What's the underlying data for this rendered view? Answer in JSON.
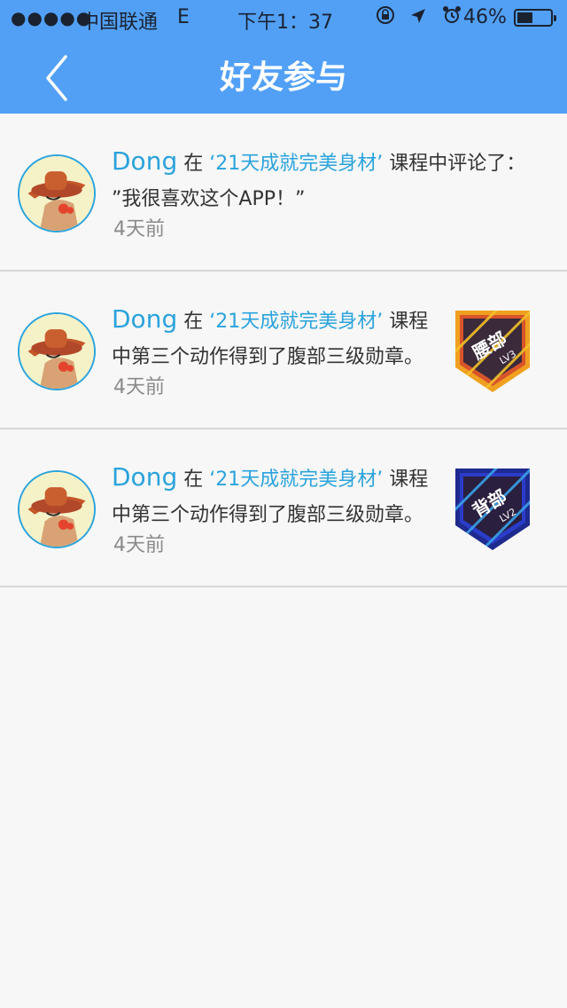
{
  "status_bar": {
    "signal": "●●●●●",
    "carrier": "中国联通",
    "network": "E",
    "time": "下午1：37",
    "icons": [
      "rotation-lock-icon",
      "location-arrow-icon",
      "alarm-icon"
    ],
    "battery_percent_text": "46%",
    "battery_level": 0.46
  },
  "header": {
    "title": "好友参与",
    "back_icon": "chevron-left-icon",
    "background_color": "#52a0f6"
  },
  "feed": [
    {
      "user": "Dong",
      "prefix": " 在 ",
      "course": "‘21天成就完美身材’",
      "suffix": " 课程中评论了：",
      "detail": "”我很喜欢这个APP！”",
      "time": "4天前",
      "badge": null
    },
    {
      "user": "Dong",
      "prefix": " 在 ",
      "course": "‘21天成就完美身材’",
      "suffix": " 课程",
      "detail": "中第三个动作得到了腹部三级勋章。",
      "time": "4天前",
      "badge": {
        "name": "腰部",
        "level": "LV3",
        "color": "#f0a020"
      }
    },
    {
      "user": "Dong",
      "prefix": " 在 ",
      "course": "‘21天成就完美身材’",
      "suffix": " 课程",
      "detail": "中第三个动作得到了腹部三级勋章。",
      "time": "4天前",
      "badge": {
        "name": "背部",
        "level": "LV2",
        "color": "#2a3cc8"
      }
    }
  ],
  "colors": {
    "accent": "#2aa3dc",
    "page_background": "#f7f7f7",
    "divider": "#d7d7d7"
  }
}
